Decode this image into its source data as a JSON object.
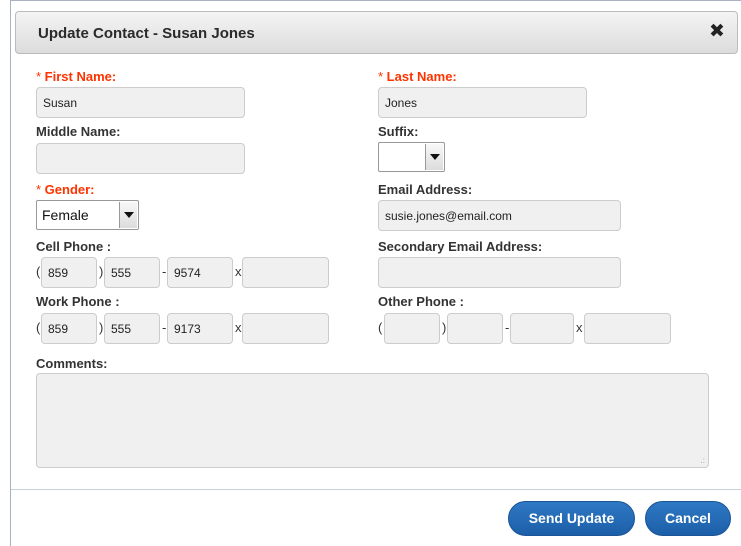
{
  "dialog": {
    "title": "Update Contact - Susan Jones"
  },
  "form": {
    "first_name": {
      "label": "First Name:",
      "required_mark": "* ",
      "value": "Susan"
    },
    "last_name": {
      "label": "Last Name:",
      "required_mark": "* ",
      "value": "Jones"
    },
    "middle_name": {
      "label": "Middle Name:",
      "value": ""
    },
    "suffix": {
      "label": "Suffix:",
      "value": ""
    },
    "gender": {
      "label": "Gender:",
      "required_mark": "* ",
      "value": "Female"
    },
    "email": {
      "label": "Email Address:",
      "value": "susie.jones@email.com"
    },
    "cell_phone": {
      "label": "Cell Phone :",
      "area": "859",
      "prefix": "555",
      "line": "9574",
      "ext": ""
    },
    "secondary_email": {
      "label": "Secondary Email Address:",
      "value": ""
    },
    "work_phone": {
      "label": "Work Phone :",
      "area": "859",
      "prefix": "555",
      "line": "9173",
      "ext": ""
    },
    "other_phone": {
      "label": "Other Phone :",
      "area": "",
      "prefix": "",
      "line": "",
      "ext": ""
    },
    "comments": {
      "label": "Comments:",
      "value": ""
    },
    "phone_separators": {
      "open_paren": "(",
      "close_paren": ")",
      "dash": "-",
      "ext": "x"
    }
  },
  "buttons": {
    "send_update": "Send Update",
    "cancel": "Cancel"
  },
  "colors": {
    "required_label": "#ff3300",
    "button_bg": "#2070b8",
    "field_bg": "#f0f0f0"
  },
  "icons": {
    "close": "close-icon",
    "dropdown": "chevron-down-icon"
  }
}
